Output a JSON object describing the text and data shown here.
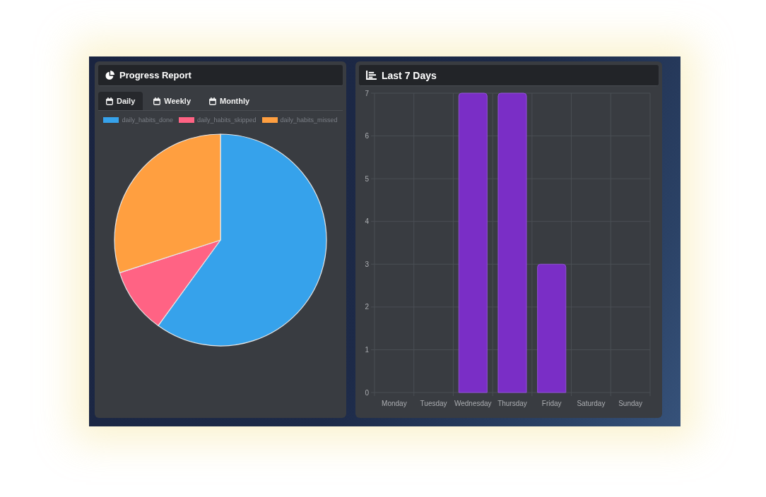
{
  "progress_report": {
    "title": "Progress Report",
    "tabs": [
      {
        "label": "Daily",
        "selected": true
      },
      {
        "label": "Weekly",
        "selected": false
      },
      {
        "label": "Monthly",
        "selected": false
      }
    ],
    "chart_data": {
      "type": "pie",
      "categories": [
        "daily_habits_done",
        "daily_habits_skipped",
        "daily_habits_missed"
      ],
      "values": [
        60,
        10,
        30
      ],
      "colors": [
        "#36a2eb",
        "#ff6384",
        "#ff9f40"
      ]
    }
  },
  "last_7_days": {
    "title": "Last 7 Days",
    "chart_data": {
      "type": "bar",
      "categories": [
        "Monday",
        "Tuesday",
        "Wednesday",
        "Thursday",
        "Friday",
        "Saturday",
        "Sunday"
      ],
      "values": [
        0,
        0,
        7,
        7,
        3,
        0,
        0
      ],
      "ylim": [
        0,
        7
      ],
      "yticks": [
        0,
        1,
        2,
        3,
        4,
        5,
        6,
        7
      ],
      "grid": true
    }
  }
}
